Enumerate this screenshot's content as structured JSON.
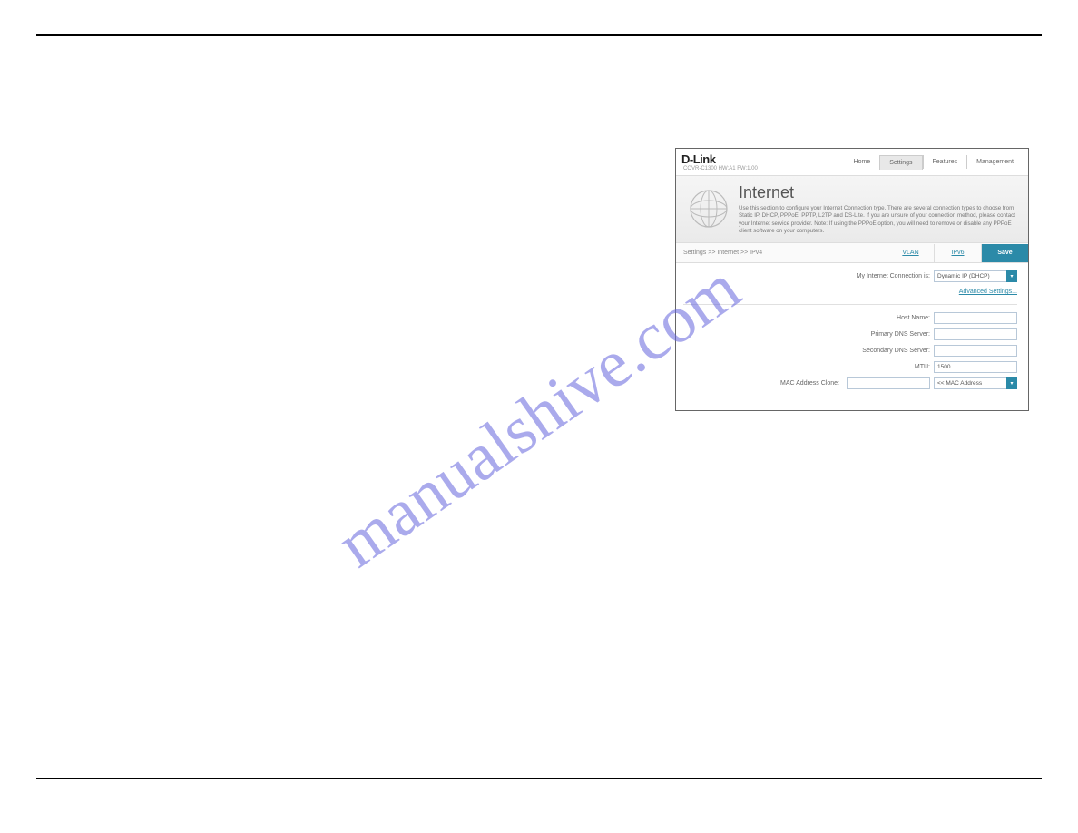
{
  "watermark": "manualshive.com",
  "panel": {
    "brand": "D-Link",
    "model": "COVR-C1300 HW:A1 FW:1.00",
    "nav": {
      "home": "Home",
      "settings": "Settings",
      "features": "Features",
      "management": "Management"
    },
    "header": {
      "title": "Internet",
      "description": "Use this section to configure your Internet Connection type. There are several connection types to choose from Static IP, DHCP, PPPoE, PPTP, L2TP and DS-Lite. If you are unsure of your connection method, please contact your Internet service provider. Note: If using the PPPoE option, you will need to remove or disable any PPPoE client software on your computers."
    },
    "breadcrumb": "Settings >> Internet >> IPv4",
    "tabs": {
      "vlan": "VLAN",
      "ipv6": "IPv6",
      "save": "Save"
    },
    "form": {
      "connection_label": "My Internet Connection is:",
      "connection_value": "Dynamic IP (DHCP)",
      "advanced": "Advanced Settings...",
      "host_name_label": "Host Name:",
      "host_name_value": "",
      "primary_dns_label": "Primary DNS Server:",
      "primary_dns_value": "",
      "secondary_dns_label": "Secondary DNS Server:",
      "secondary_dns_value": "",
      "mtu_label": "MTU:",
      "mtu_value": "1500",
      "mac_label": "MAC Address Clone:",
      "mac_value": "",
      "mac_select": "<< MAC Address"
    }
  }
}
